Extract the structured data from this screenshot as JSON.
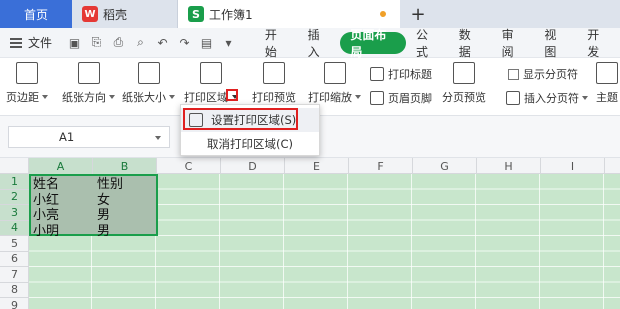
{
  "tabs": {
    "home": "首页",
    "daoke": "稻壳",
    "workbook": "工作簿1",
    "add": "+"
  },
  "menu": {
    "file": "文件",
    "ribbon_tabs": [
      "开始",
      "插入",
      "页面布局",
      "公式",
      "数据",
      "审阅",
      "视图",
      "开发"
    ],
    "active_tab": "页面布局"
  },
  "ribbon": {
    "margins": "页边距",
    "orientation": "纸张方向",
    "size": "纸张大小",
    "print_area": "打印区域",
    "print_preview": "打印预览",
    "print_scale": "打印缩放",
    "print_titles": "打印标题",
    "header_footer": "页眉页脚",
    "page_break_preview": "分页预览",
    "show_page_breaks": "显示分页符",
    "insert_page_break": "插入分页符",
    "theme": "主题"
  },
  "dropdown": {
    "set_print_area": "设置打印区域(S)",
    "cancel_print_area": "取消打印区域(C)"
  },
  "formula_bar": {
    "name_box": "A1"
  },
  "grid": {
    "columns": [
      "A",
      "B",
      "C",
      "D",
      "E",
      "F",
      "G",
      "H",
      "I"
    ],
    "rows": [
      "1",
      "2",
      "3",
      "4",
      "5",
      "6",
      "7",
      "8",
      "9"
    ],
    "cells": [
      [
        "姓名",
        "性别"
      ],
      [
        "小红",
        "女"
      ],
      [
        "小亮",
        "男"
      ],
      [
        "小明",
        "男"
      ]
    ]
  },
  "colors": {
    "accent_green": "#1a9e4b",
    "home_tab_blue": "#3a6fd8",
    "highlight_red": "#e02020",
    "sheet_green": "#c8e6cc"
  }
}
